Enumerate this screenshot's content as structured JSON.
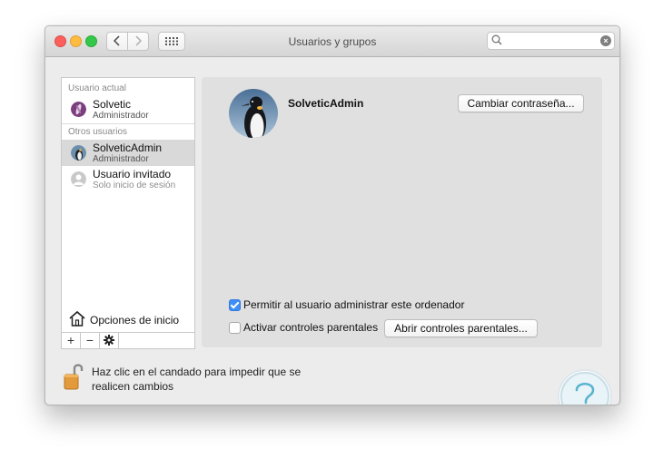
{
  "window": {
    "title": "Usuarios y grupos",
    "search_placeholder": ""
  },
  "sidebar": {
    "current_user_header": "Usuario actual",
    "current_user": {
      "name": "Solvetic",
      "role": "Administrador"
    },
    "other_users_header": "Otros usuarios",
    "other_users": [
      {
        "name": "SolveticAdmin",
        "role": "Administrador",
        "selected": true
      },
      {
        "name": "Usuario invitado",
        "role": "Solo inicio de sesión",
        "selected": false
      }
    ],
    "login_options_label": "Opciones de inicio",
    "add_label": "+",
    "remove_label": "−"
  },
  "detail": {
    "user_name": "SolveticAdmin",
    "change_password_label": "Cambiar contraseña...",
    "allow_admin_label": "Permitir al usuario administrar este ordenador",
    "allow_admin_checked": true,
    "parental_label": "Activar controles parentales",
    "parental_checked": false,
    "open_parental_label": "Abrir controles parentales..."
  },
  "footer": {
    "lock_text_line1": "Haz clic en el candado para impedir que se",
    "lock_text_line2": "realicen cambios"
  },
  "colors": {
    "accent": "#3d8ef7",
    "selection": "#d9d9d9",
    "lock_body": "#e39a3b"
  }
}
